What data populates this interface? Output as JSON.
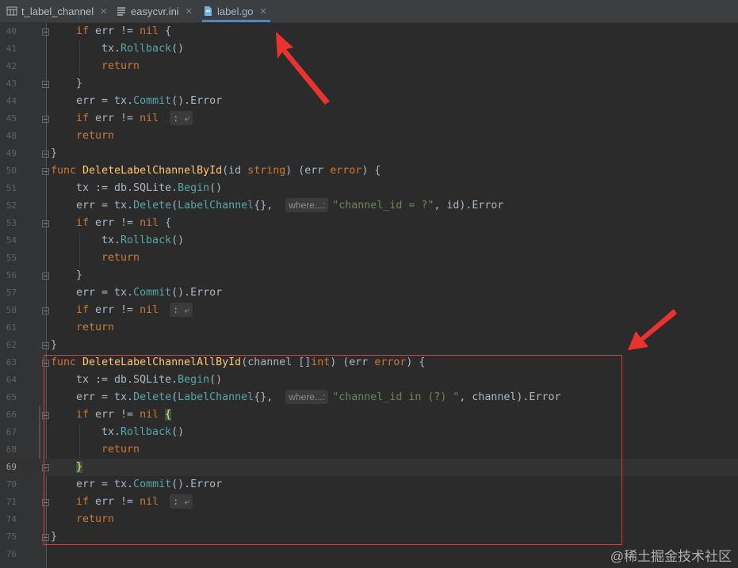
{
  "tabs": [
    {
      "label": "t_label_channel",
      "icon": "table-icon",
      "active": false
    },
    {
      "label": "easycvr.ini",
      "icon": "ini-file-icon",
      "active": false
    },
    {
      "label": "label.go",
      "icon": "go-file-icon",
      "active": true
    }
  ],
  "lines": [
    {
      "n": "40",
      "indent": 1,
      "html": "<span class='kw'>if</span> err != <span class='kw'>nil</span> {"
    },
    {
      "n": "41",
      "indent": 2,
      "html": "tx.<span class='mth'>Rollback</span>()"
    },
    {
      "n": "42",
      "indent": 2,
      "html": "<span class='kw'>return</span>"
    },
    {
      "n": "43",
      "indent": 1,
      "html": "}"
    },
    {
      "n": "44",
      "indent": 1,
      "html": "err = tx.<span class='mth'>Commit</span>().Error"
    },
    {
      "n": "45",
      "indent": 1,
      "html": "<span class='kw'>if</span> err != <span class='kw'>nil</span> <span class='fold'>: ⤶</span>"
    },
    {
      "n": "48",
      "indent": 1,
      "html": "<span class='kw'>return</span>"
    },
    {
      "n": "49",
      "indent": 0,
      "html": "}"
    },
    {
      "n": "50",
      "indent": 0,
      "html": "<span class='kw'>func</span> <span class='fn'>DeleteLabelChannelById</span>(id <span class='ty'>string</span>) (err <span class='ty'>error</span>) {"
    },
    {
      "n": "51",
      "indent": 1,
      "html": "tx := db.SQLite.<span class='mth'>Begin</span>()"
    },
    {
      "n": "52",
      "indent": 1,
      "html": "err = tx.<span class='mth'>Delete</span>(<span class='mth'>LabelChannel</span>{}, <span class='hint'>where...:</span><span class='str'>\"channel_id = ?\"</span>, id).Error"
    },
    {
      "n": "53",
      "indent": 1,
      "html": "<span class='kw'>if</span> err != <span class='kw'>nil</span> {"
    },
    {
      "n": "54",
      "indent": 2,
      "html": "tx.<span class='mth'>Rollback</span>()"
    },
    {
      "n": "55",
      "indent": 2,
      "html": "<span class='kw'>return</span>"
    },
    {
      "n": "56",
      "indent": 1,
      "html": "}"
    },
    {
      "n": "57",
      "indent": 1,
      "html": "err = tx.<span class='mth'>Commit</span>().Error"
    },
    {
      "n": "58",
      "indent": 1,
      "html": "<span class='kw'>if</span> err != <span class='kw'>nil</span> <span class='fold'>: ⤶</span>"
    },
    {
      "n": "61",
      "indent": 1,
      "html": "<span class='kw'>return</span>"
    },
    {
      "n": "62",
      "indent": 0,
      "html": "}"
    },
    {
      "n": "63",
      "indent": 0,
      "html": "<span class='kw'>func</span> <span class='fn'>DeleteLabelChannelAllById</span>(channel []<span class='ty'>int</span>) (err <span class='ty'>error</span>) {"
    },
    {
      "n": "64",
      "indent": 1,
      "html": "tx := db.SQLite.<span class='mth'>Begin</span>()"
    },
    {
      "n": "65",
      "indent": 1,
      "html": "err = tx.<span class='mth'>Delete</span>(<span class='mth'>LabelChannel</span>{}, <span class='hint'>where...:</span><span class='str'>\"channel_id in (?) \"</span>, channel).Error"
    },
    {
      "n": "66",
      "indent": 1,
      "html": "<span class='kw'>if</span> err != <span class='kw'>nil</span> <span class='bracehl'>{</span>"
    },
    {
      "n": "67",
      "indent": 2,
      "html": "tx.<span class='mth'>Rollback</span>()"
    },
    {
      "n": "68",
      "indent": 2,
      "html": "<span class='kw'>return</span>"
    },
    {
      "n": "69",
      "indent": 1,
      "html": "<span class='bracehl'>}</span>",
      "current": true
    },
    {
      "n": "70",
      "indent": 1,
      "html": "err = tx.<span class='mth'>Commit</span>().Error"
    },
    {
      "n": "71",
      "indent": 1,
      "html": "<span class='kw'>if</span> err != <span class='kw'>nil</span> <span class='fold'>: ⤶</span>"
    },
    {
      "n": "74",
      "indent": 1,
      "html": "<span class='kw'>return</span>"
    },
    {
      "n": "75",
      "indent": 0,
      "html": "}"
    },
    {
      "n": "76",
      "indent": 0,
      "html": ""
    }
  ],
  "watermark": "@稀土掘金技术社区",
  "colors": {
    "accent": "#4a88c7",
    "annotation": "#e0393e"
  }
}
